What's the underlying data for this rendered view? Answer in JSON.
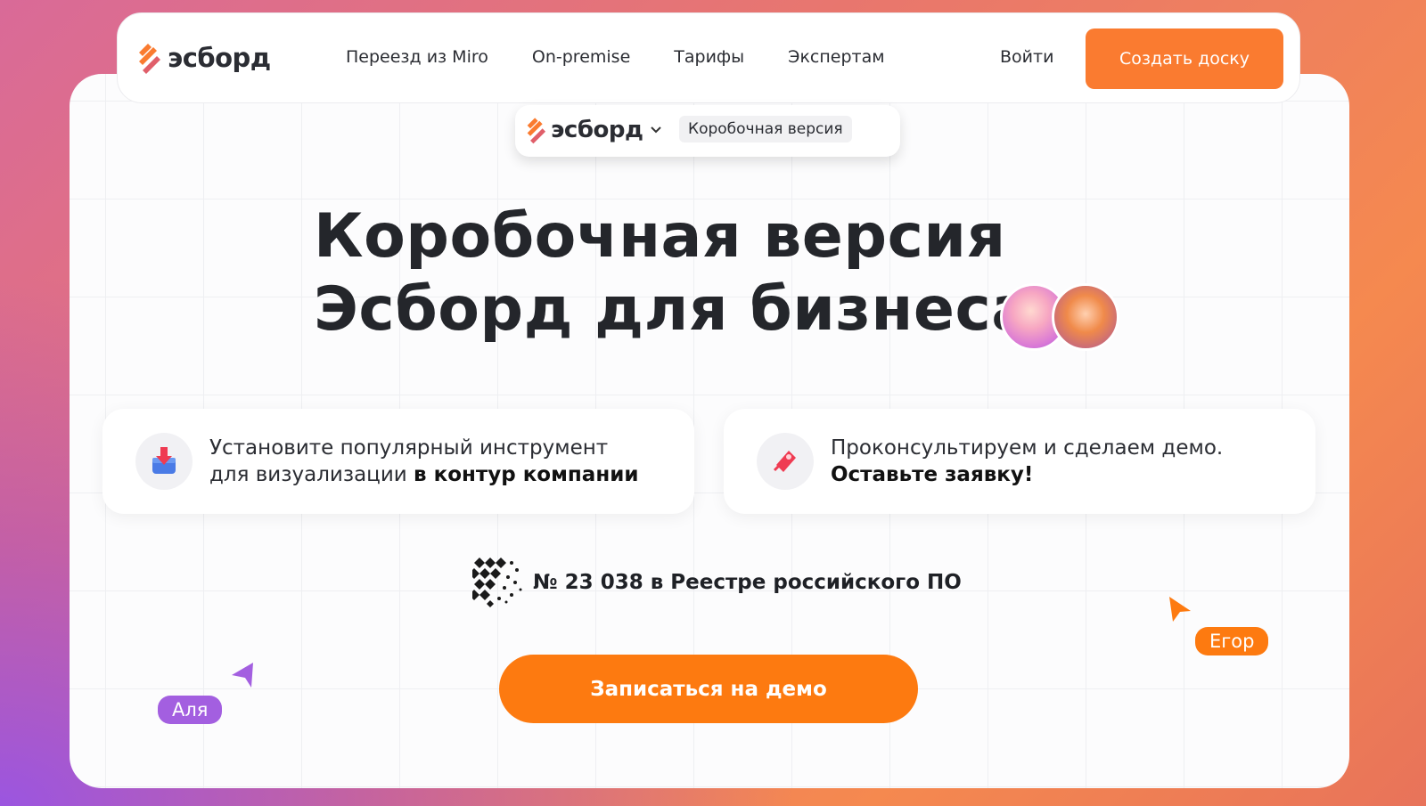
{
  "brand": {
    "name": "эсборд"
  },
  "nav": {
    "links": [
      "Переезд из Miro",
      "On-premise",
      "Тарифы",
      "Экспертам"
    ],
    "login_label": "Войти",
    "cta_label": "Создать доску"
  },
  "product_switch": {
    "brand_name": "эсборд",
    "tag": "Коробочная версия"
  },
  "hero": {
    "title_line1": "Коробочная версия",
    "title_line2": "Эсборд для бизнеса"
  },
  "features": [
    {
      "text": "Установите популярный инструмент",
      "text2": "для визуализации ",
      "bold": "в контур компании"
    },
    {
      "text": "Проконсультируем и сделаем демо.",
      "bold": "Оставьте заявку!"
    }
  ],
  "registry": {
    "text": "№ 23 038 в Реестре российского ПО"
  },
  "cta_main": {
    "label": "Записаться на демо"
  },
  "cursors": {
    "left_name": "Аля",
    "right_name": "Егор"
  },
  "colors": {
    "accent": "#fd7a10",
    "violet": "#a35fe0",
    "text": "#24262b"
  }
}
